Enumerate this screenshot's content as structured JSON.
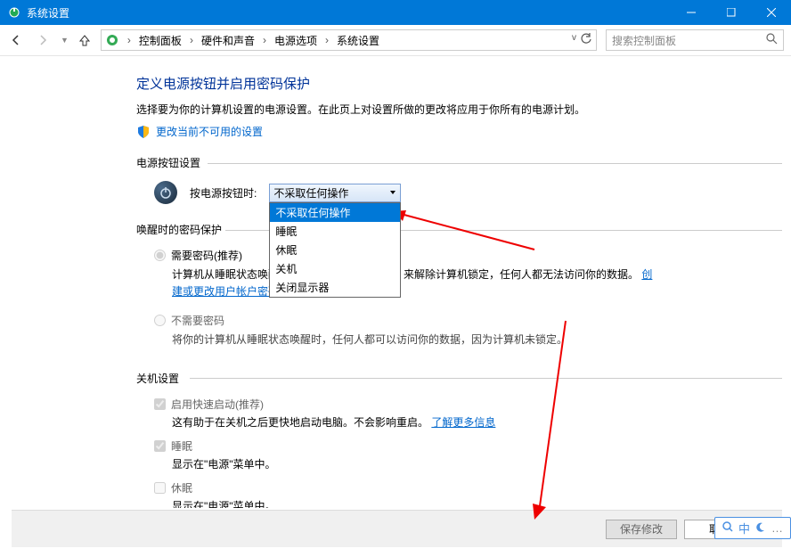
{
  "window": {
    "title": "系统设置"
  },
  "breadcrumb": {
    "items": [
      "控制面板",
      "硬件和声音",
      "电源选项",
      "系统设置"
    ]
  },
  "search": {
    "placeholder": "搜索控制面板"
  },
  "page": {
    "heading": "定义电源按钮并启用密码保护",
    "description": "选择要为你的计算机设置的电源设置。在此页上对设置所做的更改将应用于你所有的电源计划。",
    "shield_link": "更改当前不可用的设置"
  },
  "sections": {
    "power_button": {
      "title": "电源按钮设置",
      "label": "按电源按钮时:",
      "selected": "不采取任何操作",
      "options": [
        "不采取任何操作",
        "睡眠",
        "休眠",
        "关机",
        "关闭显示器"
      ]
    },
    "wake": {
      "title": "唤醒时的密码保护",
      "option1": {
        "label": "需要密码(推荐)",
        "desc_part1": "计算机从睡眠状态唤醒",
        "desc_part2": "来解除计算机锁定，任何人都无法访问你的数据。",
        "link": "创建或更改用户帐户密码"
      },
      "option2": {
        "label": "不需要密码",
        "desc": "将你的计算机从睡眠状态唤醒时，任何人都可以访问你的数据，因为计算机未锁定。"
      }
    },
    "shutdown": {
      "title": "关机设置",
      "items": [
        {
          "label": "启用快速启动(推荐)",
          "desc_pre": "这有助于在关机之后更快地启动电脑。不会影响重启。",
          "link": "了解更多信息"
        },
        {
          "label": "睡眠",
          "desc": "显示在\"电源\"菜单中。"
        },
        {
          "label": "休眠",
          "desc": "显示在\"电源\"菜单中。"
        }
      ]
    }
  },
  "footer": {
    "save": "保存修改",
    "cancel": "取消"
  },
  "ime": {
    "char": "中"
  }
}
